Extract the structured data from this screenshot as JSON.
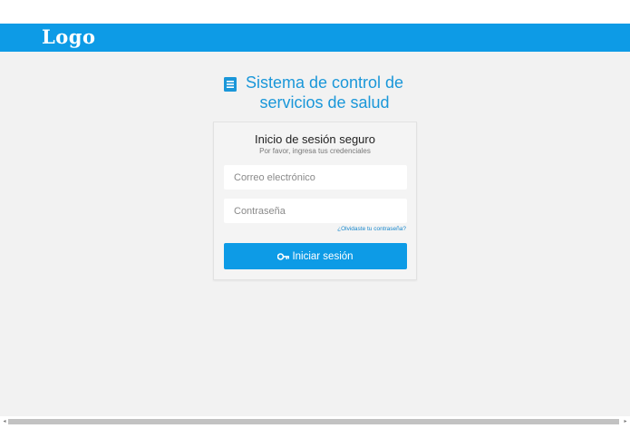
{
  "header": {
    "logo_text": "Logo",
    "color": "#0d9be6"
  },
  "app": {
    "title": "Sistema de control de servicios de salud",
    "title_icon": "document-icon",
    "accent_color": "#1a97d9"
  },
  "login": {
    "title": "Inicio de sesión seguro",
    "subtitle": "Por favor, ingresa tus credenciales",
    "email": {
      "value": "",
      "placeholder": "Correo electrónico"
    },
    "password": {
      "value": "",
      "placeholder": "Contraseña"
    },
    "forgot_link": "¿Olvidaste tu contraseña?",
    "submit_label": "Iniciar sesión",
    "submit_icon": "key-icon"
  },
  "scrollbar": {
    "left_arrow": "◂",
    "right_arrow": "▸"
  }
}
